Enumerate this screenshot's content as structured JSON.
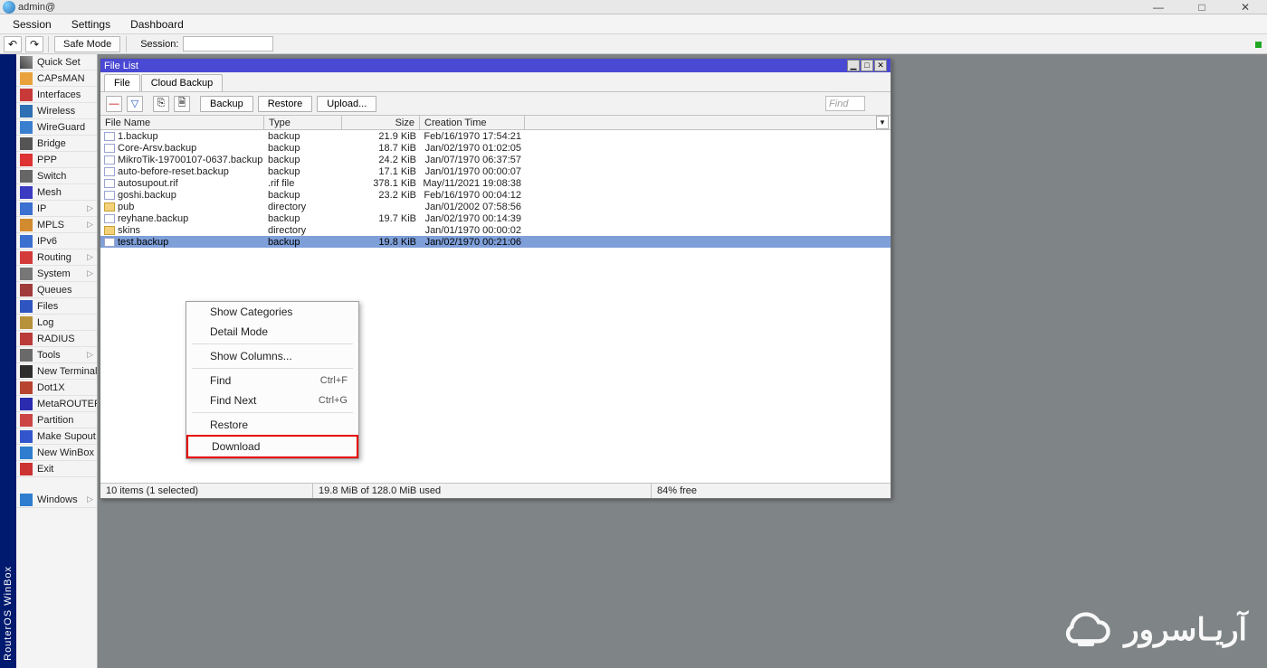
{
  "window": {
    "title": "admin@",
    "minimize": "—",
    "maximize": "□",
    "close": "✕"
  },
  "menubar": [
    "Session",
    "Settings",
    "Dashboard"
  ],
  "toolbar": {
    "back": "↶",
    "fwd": "↷",
    "safemode": "Safe Mode",
    "sessionlabel": "Session:"
  },
  "sidebar": {
    "title": "RouterOS WinBox",
    "items": [
      {
        "icon": "wand",
        "label": "Quick Set"
      },
      {
        "icon": "antenna",
        "label": "CAPsMAN"
      },
      {
        "icon": "if",
        "label": "Interfaces"
      },
      {
        "icon": "wifi",
        "label": "Wireless"
      },
      {
        "icon": "wg",
        "label": "WireGuard"
      },
      {
        "icon": "bridge",
        "label": "Bridge"
      },
      {
        "icon": "ppp",
        "label": "PPP"
      },
      {
        "icon": "sw",
        "label": "Switch"
      },
      {
        "icon": "mesh",
        "label": "Mesh"
      },
      {
        "icon": "ip",
        "label": "IP",
        "arrow": true
      },
      {
        "icon": "mpls",
        "label": "MPLS",
        "arrow": true
      },
      {
        "icon": "ipv6",
        "label": "IPv6"
      },
      {
        "icon": "route",
        "label": "Routing",
        "arrow": true
      },
      {
        "icon": "sys",
        "label": "System",
        "arrow": true
      },
      {
        "icon": "q",
        "label": "Queues"
      },
      {
        "icon": "files",
        "label": "Files"
      },
      {
        "icon": "log",
        "label": "Log"
      },
      {
        "icon": "radius",
        "label": "RADIUS"
      },
      {
        "icon": "tools",
        "label": "Tools",
        "arrow": true
      },
      {
        "icon": "term",
        "label": "New Terminal"
      },
      {
        "icon": "dot1x",
        "label": "Dot1X"
      },
      {
        "icon": "mr",
        "label": "MetaROUTER"
      },
      {
        "icon": "part",
        "label": "Partition"
      },
      {
        "icon": "supout",
        "label": "Make Supout.rif"
      },
      {
        "icon": "nwb",
        "label": "New WinBox"
      },
      {
        "icon": "exit",
        "label": "Exit"
      },
      {
        "icon": "win",
        "label": "Windows",
        "arrow": true,
        "gap": true
      }
    ]
  },
  "filewin": {
    "title": "File List",
    "tabs": [
      "File",
      "Cloud Backup"
    ],
    "active_tab": 0,
    "buttons": {
      "remove": "—",
      "filter": "▽",
      "copy": "⎘",
      "paste": "🗎",
      "backup": "Backup",
      "restore": "Restore",
      "upload": "Upload..."
    },
    "find_placeholder": "Find",
    "columns": [
      "File Name",
      "Type",
      "Size",
      "Creation Time"
    ],
    "dropdown": "▼",
    "rows": [
      {
        "icon": "file",
        "name": "1.backup",
        "type": "backup",
        "size": "21.9 KiB",
        "date": "Feb/16/1970 17:54:21"
      },
      {
        "icon": "file",
        "name": "Core-Arsv.backup",
        "type": "backup",
        "size": "18.7 KiB",
        "date": "Jan/02/1970 01:02:05"
      },
      {
        "icon": "file",
        "name": "MikroTik-19700107-0637.backup",
        "type": "backup",
        "size": "24.2 KiB",
        "date": "Jan/07/1970 06:37:57"
      },
      {
        "icon": "file",
        "name": "auto-before-reset.backup",
        "type": "backup",
        "size": "17.1 KiB",
        "date": "Jan/01/1970 00:00:07"
      },
      {
        "icon": "file",
        "name": "autosupout.rif",
        "type": ".rif file",
        "size": "378.1 KiB",
        "date": "May/11/2021 19:08:38"
      },
      {
        "icon": "file",
        "name": "goshi.backup",
        "type": "backup",
        "size": "23.2 KiB",
        "date": "Feb/16/1970 00:04:12"
      },
      {
        "icon": "folder",
        "name": "pub",
        "type": "directory",
        "size": "",
        "date": "Jan/01/2002 07:58:56"
      },
      {
        "icon": "file",
        "name": "reyhane.backup",
        "type": "backup",
        "size": "19.7 KiB",
        "date": "Jan/02/1970 00:14:39"
      },
      {
        "icon": "folder",
        "name": "skins",
        "type": "directory",
        "size": "",
        "date": "Jan/01/1970 00:00:02"
      },
      {
        "icon": "file",
        "name": "test.backup",
        "type": "backup",
        "size": "19.8 KiB",
        "date": "Jan/02/1970 00:21:06",
        "selected": true
      }
    ],
    "status": {
      "s1": "10 items (1 selected)",
      "s2": "19.8 MiB of 128.0 MiB used",
      "s3": "84% free"
    }
  },
  "contextmenu": {
    "items": [
      {
        "label": "Show Categories"
      },
      {
        "label": "Detail Mode"
      },
      {
        "hr": true
      },
      {
        "label": "Show Columns..."
      },
      {
        "hr": true
      },
      {
        "label": "Find",
        "shortcut": "Ctrl+F"
      },
      {
        "label": "Find Next",
        "shortcut": "Ctrl+G"
      },
      {
        "hr": true
      },
      {
        "label": "Restore"
      },
      {
        "label": "Download",
        "highlight": true
      }
    ]
  },
  "watermark": "آریـاسرور"
}
